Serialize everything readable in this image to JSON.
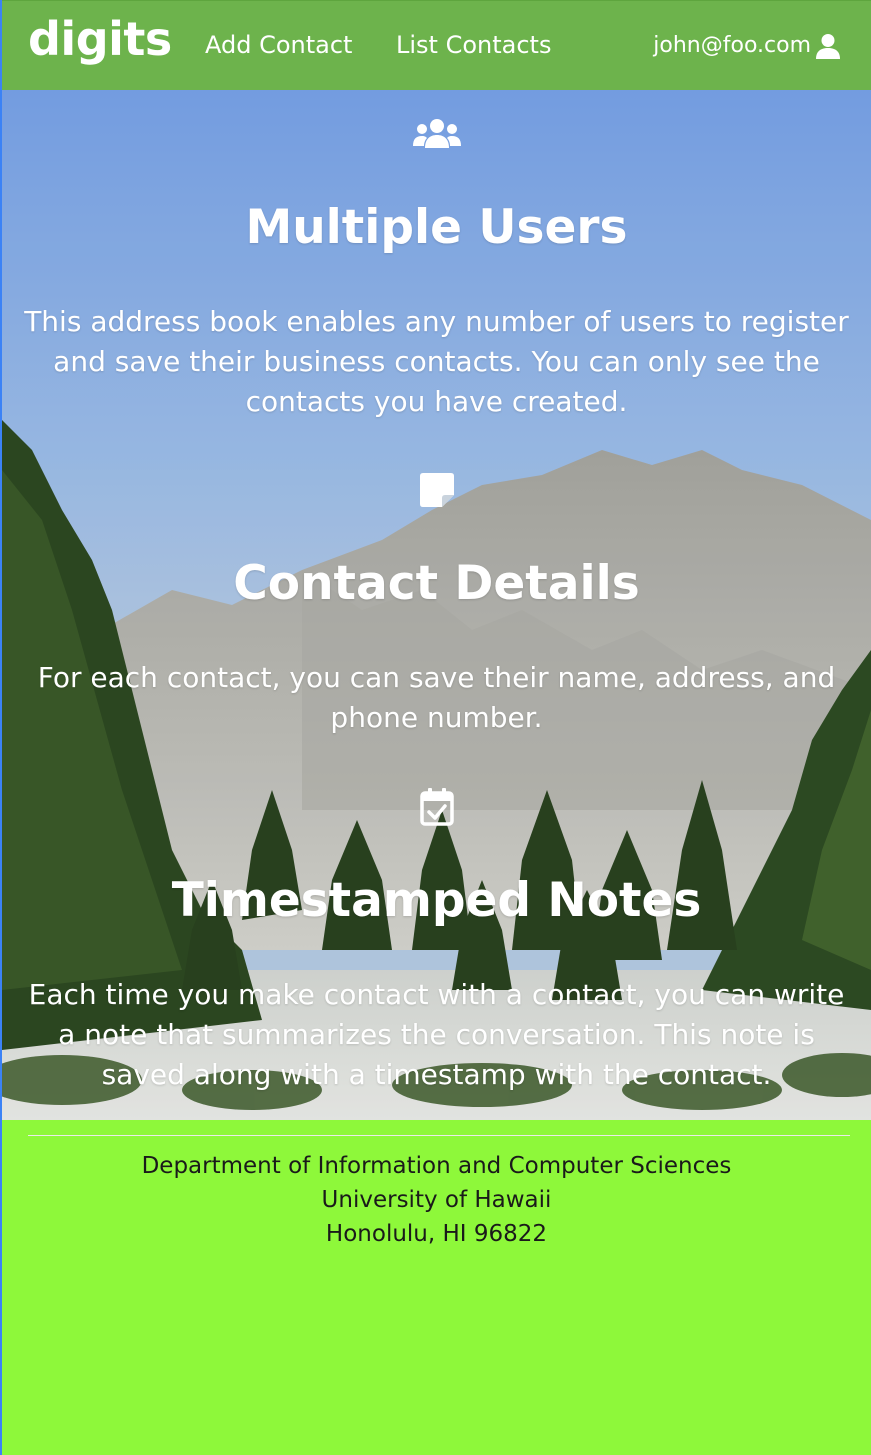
{
  "navbar": {
    "brand": "digits",
    "add_contact": "Add Contact",
    "list_contacts": "List Contacts",
    "user_email": "john@foo.com",
    "user_icon": "user-icon"
  },
  "features": [
    {
      "icon": "users-icon",
      "title": "Multiple Users",
      "description": "This address book enables any number of users to register and save their business contacts. You can only see the contacts you have created."
    },
    {
      "icon": "sticky-note-icon",
      "title": "Contact Details",
      "description": "For each contact, you can save their name, address, and phone number."
    },
    {
      "icon": "calendar-check-icon",
      "title": "Timestamped Notes",
      "description": "Each time you make contact with a contact, you can write a note that summarizes the conversation. This note is saved along with a timestamp with the contact."
    }
  ],
  "footer": {
    "line1": "Department of Information and Computer Sciences",
    "line2": "University of Hawaii",
    "line3": "Honolulu, HI 96822"
  },
  "colors": {
    "navbar": "#6db34c",
    "footer": "#8ef83a",
    "text": "#ffffff"
  }
}
